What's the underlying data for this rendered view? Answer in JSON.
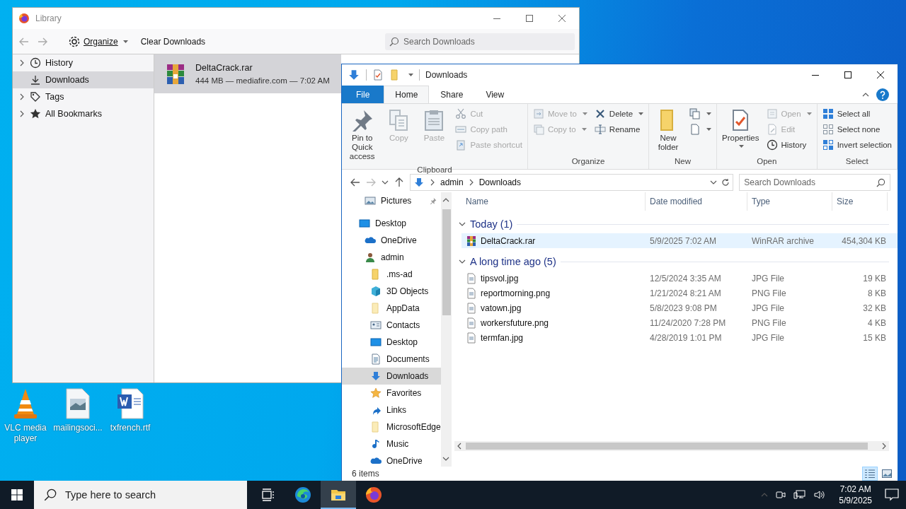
{
  "desktop": {
    "icons": [
      {
        "label": "VLC media player",
        "kind": "vlc"
      },
      {
        "label": "mailingsoci...",
        "kind": "image"
      },
      {
        "label": "txfrench.rtf",
        "kind": "word"
      }
    ]
  },
  "library": {
    "title": "Library",
    "organize": "Organize",
    "clear": "Clear Downloads",
    "search_placeholder": "Search Downloads",
    "sidebar": [
      {
        "label": "History",
        "kind": "history",
        "expandable": true,
        "selected": false
      },
      {
        "label": "Downloads",
        "kind": "downloads",
        "expandable": false,
        "selected": true
      },
      {
        "label": "Tags",
        "kind": "tags",
        "expandable": true,
        "selected": false
      },
      {
        "label": "All Bookmarks",
        "kind": "bookmarks",
        "expandable": true,
        "selected": false
      }
    ],
    "downloads": [
      {
        "name": "DeltaCrack.rar",
        "details": "444 MB — mediafire.com — 7:02 AM",
        "selected": true
      }
    ]
  },
  "explorer": {
    "title": "Downloads",
    "tabs": [
      {
        "label": "File",
        "kind": "file",
        "selected": false
      },
      {
        "label": "Home",
        "kind": "tab",
        "selected": true
      },
      {
        "label": "Share",
        "kind": "tab",
        "selected": false
      },
      {
        "label": "View",
        "kind": "tab",
        "selected": false
      }
    ],
    "ribbon": [
      {
        "title": "Clipboard",
        "columns": [
          [
            {
              "label": "Pin to Quick access",
              "kind": "pin",
              "disabled": false
            }
          ],
          [
            {
              "label": "Copy",
              "kind": "copy",
              "disabled": true
            }
          ],
          [
            {
              "label": "Paste",
              "kind": "paste",
              "disabled": true
            }
          ],
          [
            {
              "label": "Cut",
              "kind": "cut",
              "disabled": true
            },
            {
              "label": "Copy path",
              "kind": "copy-path",
              "disabled": true
            },
            {
              "label": "Paste shortcut",
              "kind": "paste-shortcut",
              "disabled": true
            }
          ]
        ]
      },
      {
        "title": "Organize",
        "columns": [
          [
            {
              "label": "Move to",
              "kind": "move",
              "disabled": true,
              "dropdown": true
            },
            {
              "label": "Copy to",
              "kind": "copy-to",
              "disabled": true,
              "dropdown": true
            }
          ],
          [
            {
              "label": "Delete",
              "kind": "delete",
              "disabled": false,
              "dropdown": true
            },
            {
              "label": "Rename",
              "kind": "rename",
              "disabled": false
            }
          ]
        ]
      },
      {
        "title": "New",
        "columns": [
          [
            {
              "label": "New folder",
              "kind": "folder",
              "disabled": false
            }
          ],
          [
            {
              "kind": "new-item",
              "disabled": false,
              "dropdown": true
            },
            {
              "kind": "easy-access",
              "disabled": false,
              "dropdown": true
            }
          ]
        ]
      },
      {
        "title": "Open",
        "columns": [
          [
            {
              "label": "Properties",
              "kind": "properties",
              "disabled": false,
              "dropdown": true
            }
          ],
          [
            {
              "label": "Open",
              "kind": "open",
              "disabled": true,
              "dropdown": true
            },
            {
              "label": "Edit",
              "kind": "edit",
              "disabled": true
            },
            {
              "label": "History",
              "kind": "history",
              "disabled": false
            }
          ]
        ]
      },
      {
        "title": "Select",
        "columns": [
          [
            {
              "label": "Select all",
              "kind": "select-all",
              "disabled": false
            },
            {
              "label": "Select none",
              "kind": "select-none",
              "disabled": false
            },
            {
              "label": "Invert selection",
              "kind": "invert",
              "disabled": false
            }
          ]
        ]
      }
    ],
    "path": [
      "admin",
      "Downloads"
    ],
    "search_placeholder": "Search Downloads",
    "quick_access": [
      {
        "label": "Pictures",
        "kind": "pictures",
        "pinned": true,
        "selected": false
      }
    ],
    "nav": [
      {
        "label": "Desktop",
        "kind": "desktop",
        "selected": false,
        "children": [
          {
            "label": "OneDrive",
            "kind": "onedrive",
            "selected": false
          },
          {
            "label": "admin",
            "kind": "user",
            "selected": false,
            "children": [
              {
                "label": ".ms-ad",
                "kind": "folder",
                "selected": false
              },
              {
                "label": "3D Objects",
                "kind": "objects",
                "selected": false
              },
              {
                "label": "AppData",
                "kind": "folder-light",
                "selected": false
              },
              {
                "label": "Contacts",
                "kind": "contacts",
                "selected": false
              },
              {
                "label": "Desktop",
                "kind": "desktop",
                "selected": false
              },
              {
                "label": "Documents",
                "kind": "documents",
                "selected": false
              },
              {
                "label": "Downloads",
                "kind": "downloads",
                "selected": true
              },
              {
                "label": "Favorites",
                "kind": "favorites",
                "selected": false
              },
              {
                "label": "Links",
                "kind": "links",
                "selected": false
              },
              {
                "label": "MicrosoftEdge",
                "kind": "folder-light",
                "selected": false
              },
              {
                "label": "Music",
                "kind": "music",
                "selected": false
              },
              {
                "label": "OneDrive",
                "kind": "onedrive",
                "selected": false
              }
            ]
          }
        ]
      }
    ],
    "columns": [
      "Name",
      "Date modified",
      "Type",
      "Size"
    ],
    "groups": [
      {
        "title": "Today (1)",
        "expanded": true,
        "files": [
          {
            "name": "DeltaCrack.rar",
            "date": "5/9/2025 7:02 AM",
            "type": "WinRAR archive",
            "size": "454,304 KB",
            "kind": "rar",
            "selected": true
          }
        ]
      },
      {
        "title": "A long time ago (5)",
        "expanded": true,
        "files": [
          {
            "name": "tipsvol.jpg",
            "date": "12/5/2024 3:35 AM",
            "type": "JPG File",
            "size": "19 KB",
            "kind": "image",
            "selected": false
          },
          {
            "name": "reportmorning.png",
            "date": "1/21/2024 8:21 AM",
            "type": "PNG File",
            "size": "8 KB",
            "kind": "image",
            "selected": false
          },
          {
            "name": "vatown.jpg",
            "date": "5/8/2023 9:08 PM",
            "type": "JPG File",
            "size": "32 KB",
            "kind": "image",
            "selected": false
          },
          {
            "name": "workersfuture.png",
            "date": "11/24/2020 7:28 PM",
            "type": "PNG File",
            "size": "4 KB",
            "kind": "image",
            "selected": false
          },
          {
            "name": "termfan.jpg",
            "date": "4/28/2019 1:01 PM",
            "type": "JPG File",
            "size": "15 KB",
            "kind": "image",
            "selected": false
          }
        ]
      }
    ],
    "status": "6 items",
    "view": [
      {
        "kind": "details",
        "selected": true
      },
      {
        "kind": "large-icons",
        "selected": false
      }
    ]
  },
  "taskbar": {
    "search_placeholder": "Type here to search",
    "apps": [
      {
        "kind": "task-view",
        "selected": false
      },
      {
        "kind": "edge",
        "selected": false
      },
      {
        "kind": "file-explorer",
        "selected": true
      },
      {
        "kind": "firefox",
        "selected": false
      }
    ],
    "time": "7:02 AM",
    "date": "5/9/2025"
  }
}
